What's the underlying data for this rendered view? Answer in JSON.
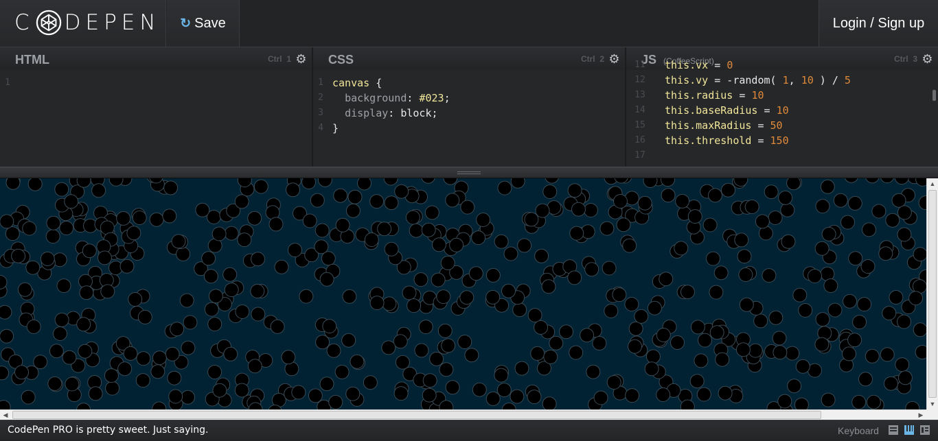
{
  "header": {
    "logo_text": "C DEPEN",
    "logo_icon": "codepen-cube-icon",
    "save_label": "Save",
    "save_icon": "refresh-icon",
    "login_label": "Login / Sign up"
  },
  "editors": {
    "html": {
      "title": "HTML",
      "shortcut": "Ctrl",
      "shortcut_key": "1",
      "lines": [
        "1"
      ]
    },
    "css": {
      "title": "CSS",
      "shortcut": "Ctrl",
      "shortcut_key": "2",
      "code": [
        {
          "n": "1",
          "parts": [
            {
              "c": "sel",
              "t": "canvas"
            },
            {
              "c": "op",
              "t": " {"
            }
          ]
        },
        {
          "n": "2",
          "parts": [
            {
              "c": "op",
              "t": "  "
            },
            {
              "c": "prop",
              "t": "background"
            },
            {
              "c": "op",
              "t": ": "
            },
            {
              "c": "hex",
              "t": "#023"
            },
            {
              "c": "op",
              "t": ";"
            }
          ]
        },
        {
          "n": "3",
          "parts": [
            {
              "c": "op",
              "t": "  "
            },
            {
              "c": "prop",
              "t": "display"
            },
            {
              "c": "op",
              "t": ": "
            },
            {
              "c": "val",
              "t": "block"
            },
            {
              "c": "op",
              "t": ";"
            }
          ]
        },
        {
          "n": "4",
          "parts": [
            {
              "c": "op",
              "t": "}"
            }
          ]
        }
      ]
    },
    "js": {
      "title": "JS",
      "preprocessor": "(CoffeeScript)",
      "shortcut": "Ctrl",
      "shortcut_key": "3",
      "code": [
        {
          "n": "11",
          "parts": [
            {
              "c": "kw",
              "t": "this.vx"
            },
            {
              "c": "op",
              "t": " = "
            },
            {
              "c": "num",
              "t": "0"
            }
          ]
        },
        {
          "n": "12",
          "parts": [
            {
              "c": "kw",
              "t": "this.vy"
            },
            {
              "c": "op",
              "t": " = -random( "
            },
            {
              "c": "num",
              "t": "1"
            },
            {
              "c": "op",
              "t": ", "
            },
            {
              "c": "num",
              "t": "10"
            },
            {
              "c": "op",
              "t": " ) / "
            },
            {
              "c": "num",
              "t": "5"
            }
          ]
        },
        {
          "n": "13",
          "parts": [
            {
              "c": "kw",
              "t": "this.radius"
            },
            {
              "c": "op",
              "t": " = "
            },
            {
              "c": "num",
              "t": "10"
            }
          ]
        },
        {
          "n": "14",
          "parts": [
            {
              "c": "kw",
              "t": "this.baseRadius"
            },
            {
              "c": "op",
              "t": " = "
            },
            {
              "c": "num",
              "t": "10"
            }
          ]
        },
        {
          "n": "15",
          "parts": [
            {
              "c": "kw",
              "t": "this.maxRadius"
            },
            {
              "c": "op",
              "t": " = "
            },
            {
              "c": "num",
              "t": "50"
            }
          ]
        },
        {
          "n": "16",
          "parts": [
            {
              "c": "kw",
              "t": "this.threshold"
            },
            {
              "c": "op",
              "t": " = "
            },
            {
              "c": "num",
              "t": "150"
            }
          ]
        },
        {
          "n": "17",
          "parts": []
        }
      ]
    }
  },
  "preview": {
    "background": "#002233",
    "circle_fill": "#000000",
    "circle_stroke": "#3a4a55"
  },
  "footer": {
    "message": "CodePen PRO is pretty sweet. Just saying.",
    "keyboard_label": "Keyboard",
    "layout_icons": [
      "layout-left-icon",
      "layout-top-icon",
      "layout-right-icon"
    ]
  },
  "colors": {
    "accent": "#6ab4e6",
    "string": "#f1e69a",
    "number": "#e08a3a"
  }
}
